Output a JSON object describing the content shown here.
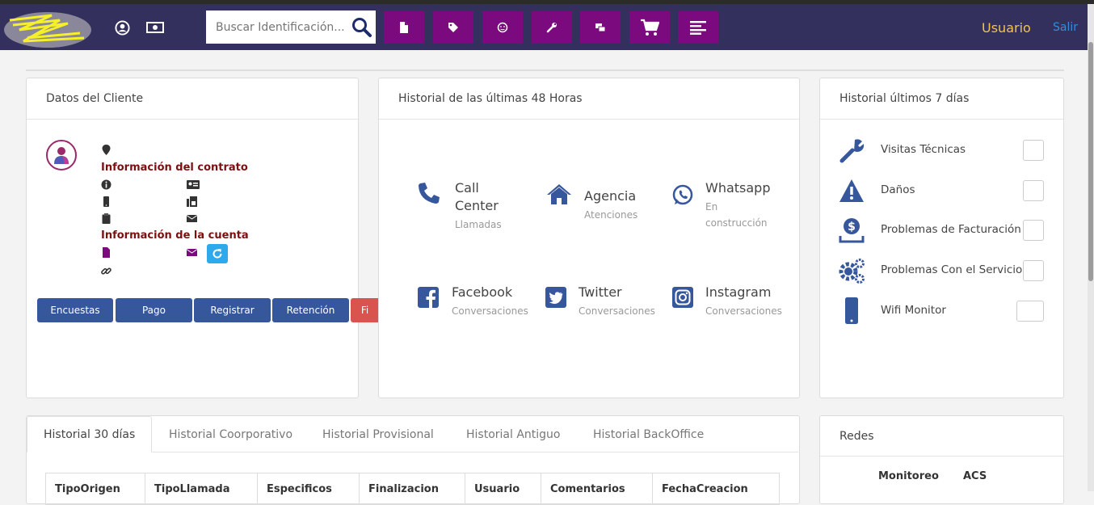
{
  "navbar": {
    "search_placeholder": "Buscar Identificación...",
    "user_label": "Usuario",
    "logout_label": "Salir",
    "accent_color": "#7b0a7e",
    "bar_color": "#33305e",
    "purple_buttons": [
      "file-icon",
      "tag-icon",
      "smile-icon",
      "wrench-icon",
      "clone-icon",
      "cart-icon",
      "list-icon"
    ]
  },
  "client_card": {
    "title": "Datos del Cliente",
    "contract_title": "Información del contrato",
    "account_title": "Información de la cuenta",
    "actions": [
      "Encuestas",
      "Pago",
      "Registrar",
      "Retención",
      "Fi"
    ]
  },
  "history48": {
    "title": "Historial de las últimas 48 Horas",
    "items": [
      {
        "title_line1": "Call",
        "title_line2": "Center",
        "sub": "Llamadas"
      },
      {
        "title_line1": "Agencia",
        "sub": "Atenciones"
      },
      {
        "title_line1": "Whatsapp",
        "sub_line1": "En",
        "sub_line2": "construcción"
      },
      {
        "title_line1": "Facebook",
        "sub": "Conversaciones"
      },
      {
        "title_line1": "Twitter",
        "sub": "Conversaciones"
      },
      {
        "title_line1": "Instagram",
        "sub": "Conversaciones"
      }
    ]
  },
  "history7": {
    "title": "Historial últimos 7 días",
    "items": [
      {
        "label": "Visitas Técnicas"
      },
      {
        "label": "Daños"
      },
      {
        "label": "Problemas de Facturación"
      },
      {
        "label": "Problemas Con el Servicio"
      },
      {
        "label": "Wifi Monitor"
      }
    ]
  },
  "history_tabs": {
    "tabs": [
      "Historial 30 días",
      "Historial Coorporativo",
      "Historial Provisional",
      "Historial Antiguo",
      "Historial BackOffice"
    ],
    "columns": [
      "TipoOrigen",
      "TipoLlamada",
      "Especificos",
      "Finalizacion",
      "Usuario",
      "Comentarios",
      "FechaCreacion"
    ]
  },
  "redes": {
    "title": "Redes",
    "columns": [
      "Monitoreo",
      "ACS"
    ]
  }
}
